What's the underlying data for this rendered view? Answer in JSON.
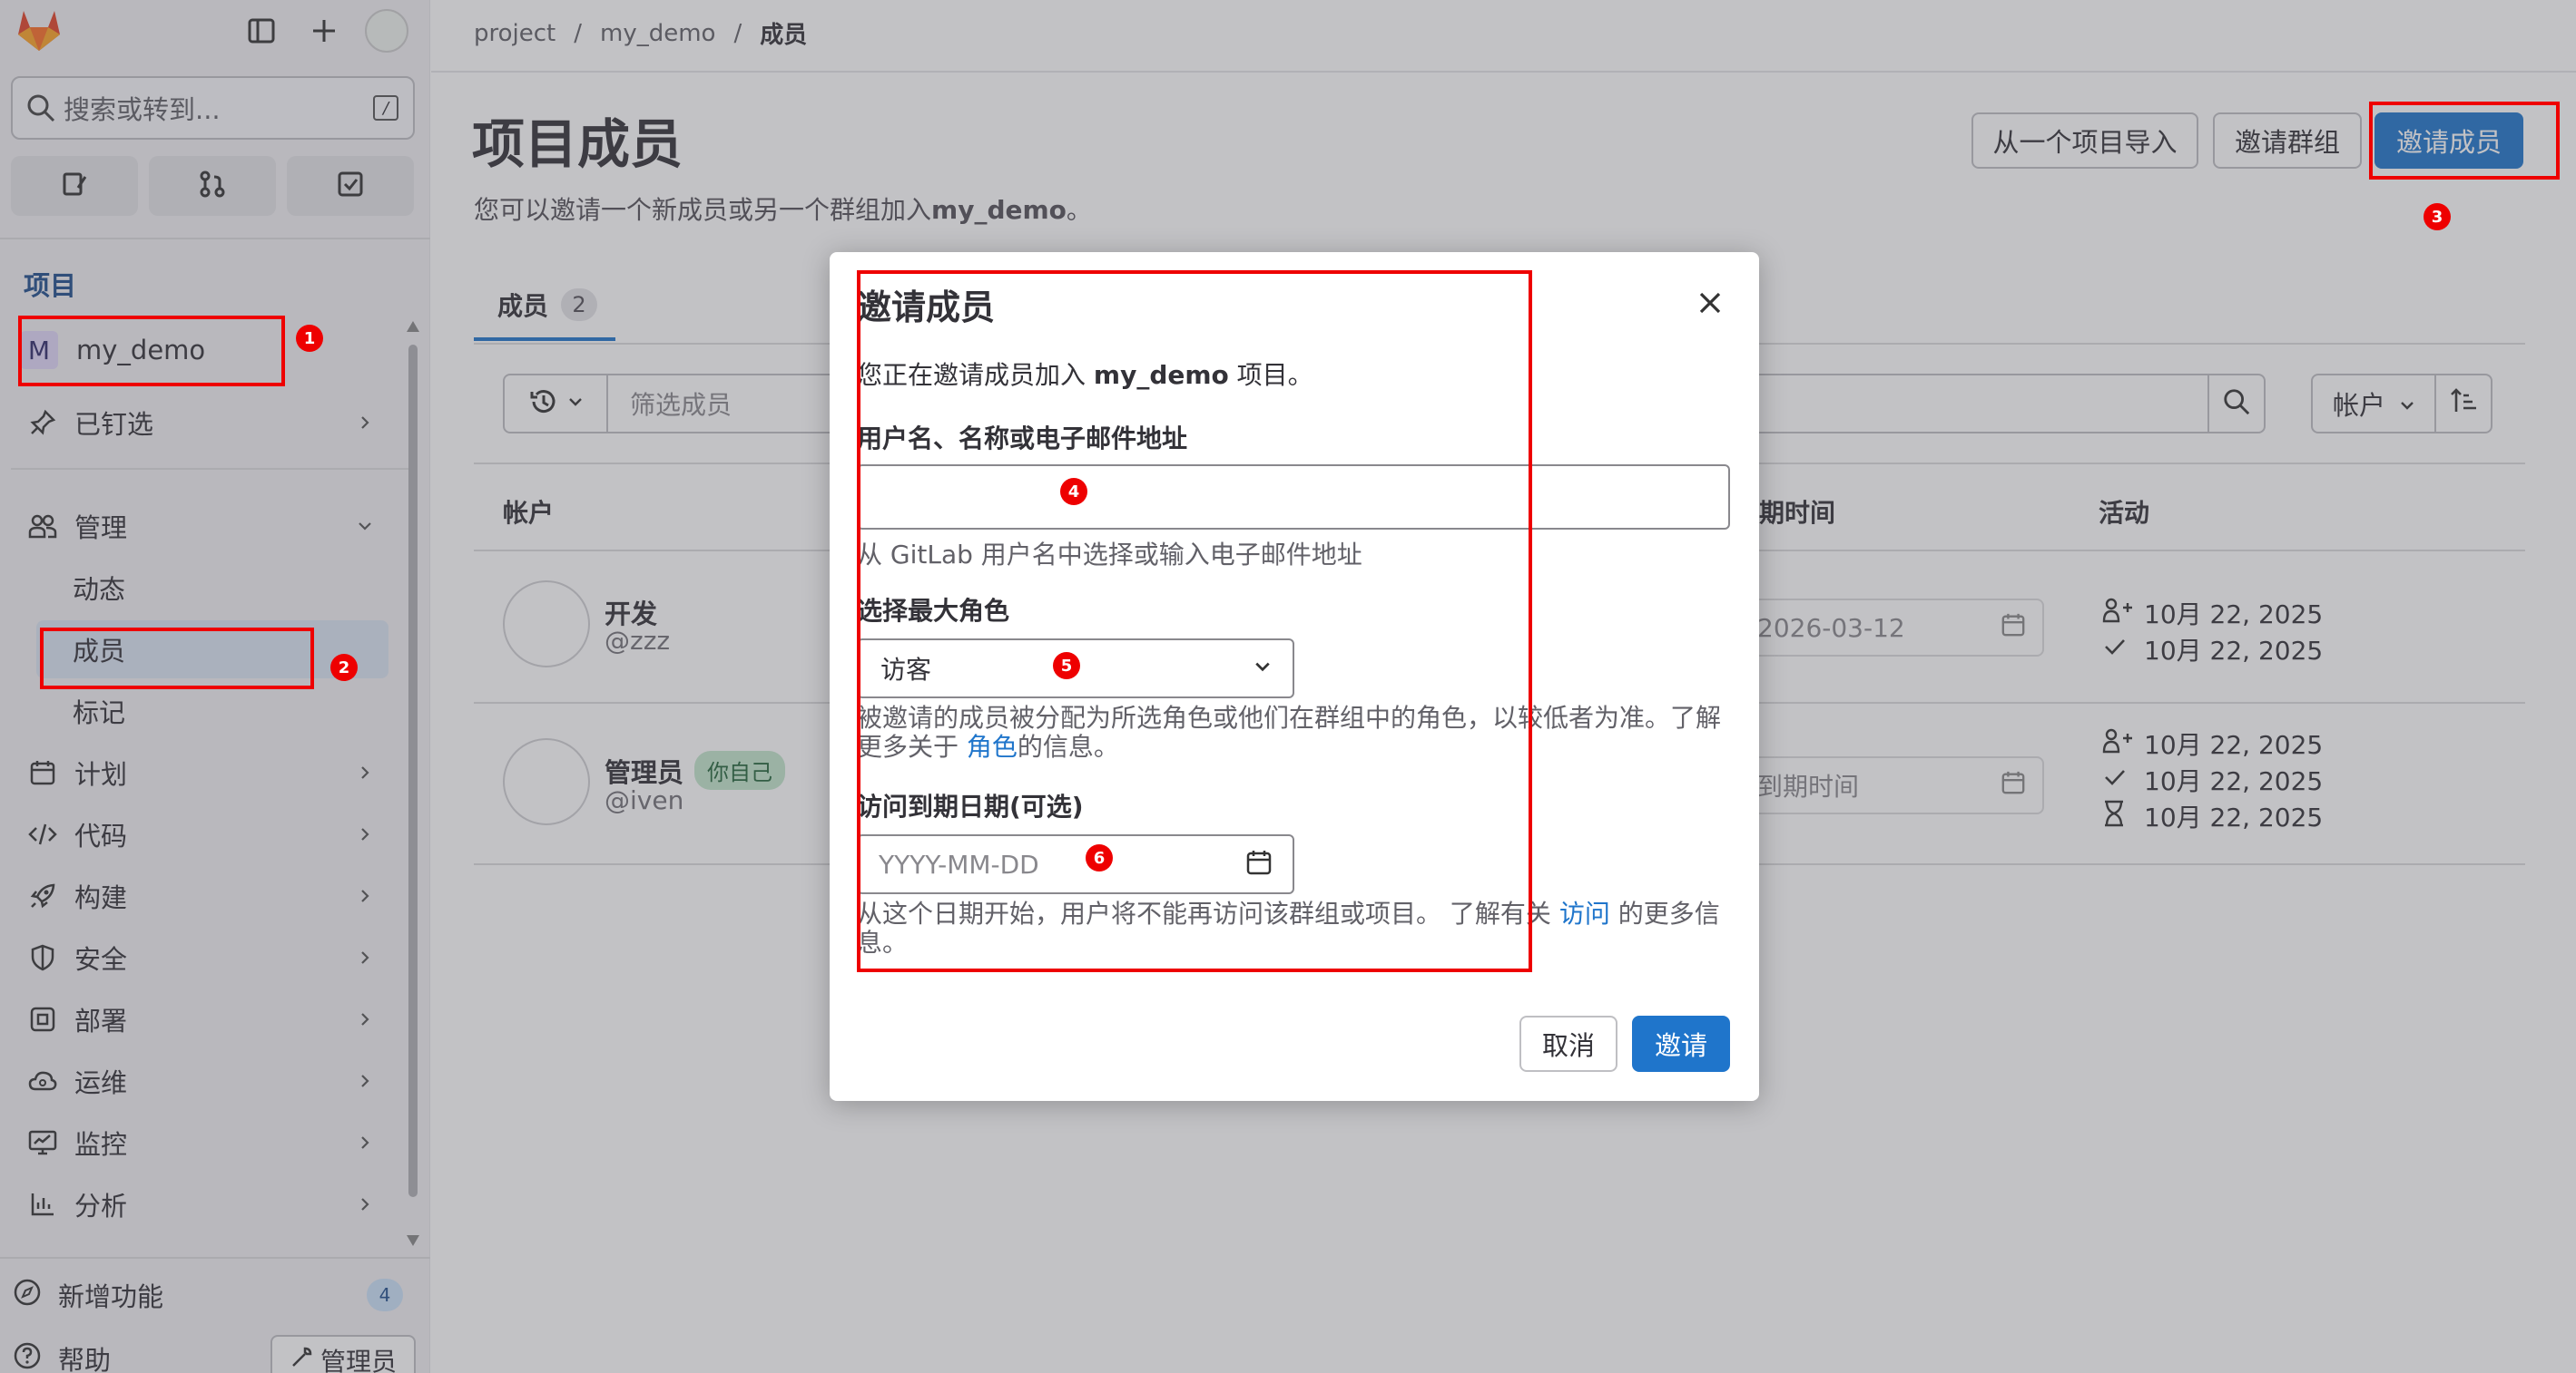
{
  "breadcrumb": {
    "items": [
      "project",
      "my_demo",
      "成员"
    ],
    "sep": "/"
  },
  "sidebar": {
    "search_placeholder": "搜索或转到...",
    "search_shortcut": "/",
    "section_title": "项目",
    "project_avatar": "M",
    "project_name": "my_demo",
    "pinned": "已钉选",
    "manage": "管理",
    "manage_items": [
      "动态",
      "成员",
      "标记"
    ],
    "items": [
      "计划",
      "代码",
      "构建",
      "安全",
      "部署",
      "运维",
      "监控",
      "分析"
    ],
    "whats_new": "新增功能",
    "whats_new_count": "4",
    "help": "帮助",
    "admin": "管理员"
  },
  "page": {
    "title": "项目成员",
    "subtitle_pre": "您可以邀请一个新成员或另一个群组加入",
    "subtitle_bold": "my_demo",
    "subtitle_post": "。",
    "import_button": "从一个项目导入",
    "invite_group_button": "邀请群组",
    "invite_member_button": "邀请成员",
    "tab_label": "成员",
    "tab_count": "2",
    "filter_placeholder": "筛选成员",
    "sort_label": "帐户"
  },
  "table": {
    "headers": {
      "account": "帐户",
      "expiry": "期时间",
      "activity": "活动"
    },
    "rows": [
      {
        "name": "开发",
        "handle": "@zzz",
        "badge": "",
        "expiry": "2026-03-12",
        "activity": [
          "10月 22, 2025",
          "10月 22, 2025"
        ]
      },
      {
        "name": "管理员",
        "handle": "@iven",
        "badge": "你自己",
        "expiry": "到期时间",
        "activity": [
          "10月 22, 2025",
          "10月 22, 2025",
          "10月 22, 2025"
        ]
      }
    ]
  },
  "modal": {
    "title": "邀请成员",
    "intro_pre": "您正在邀请成员加入 ",
    "intro_bold": "my_demo",
    "intro_post": " 项目。",
    "username_label": "用户名、名称或电子邮件地址",
    "username_help": "从 GitLab 用户名中选择或输入电子邮件地址",
    "role_label": "选择最大角色",
    "role_value": "访客",
    "role_help_pre": "被邀请的成员被分配为所选角色或他们在群组中的角色，以较低者为准。了解更多关于 ",
    "role_help_link": "角色",
    "role_help_post": "的信息。",
    "expiry_label": "访问到期日期(可选)",
    "expiry_placeholder": "YYYY-MM-DD",
    "expiry_help_pre": "从这个日期开始，用户将不能再访问该群组或项目。 了解有关 ",
    "expiry_help_link": "访问",
    "expiry_help_post": " 的更多信息。",
    "cancel": "取消",
    "invite": "邀请"
  },
  "markers": [
    "1",
    "2",
    "3",
    "4",
    "5",
    "6"
  ],
  "colors": {
    "accent": "#1f75cb",
    "annotation": "#e00000",
    "sidebar_bg": "#f1f0f3",
    "active_item": "#dbe5f3"
  }
}
